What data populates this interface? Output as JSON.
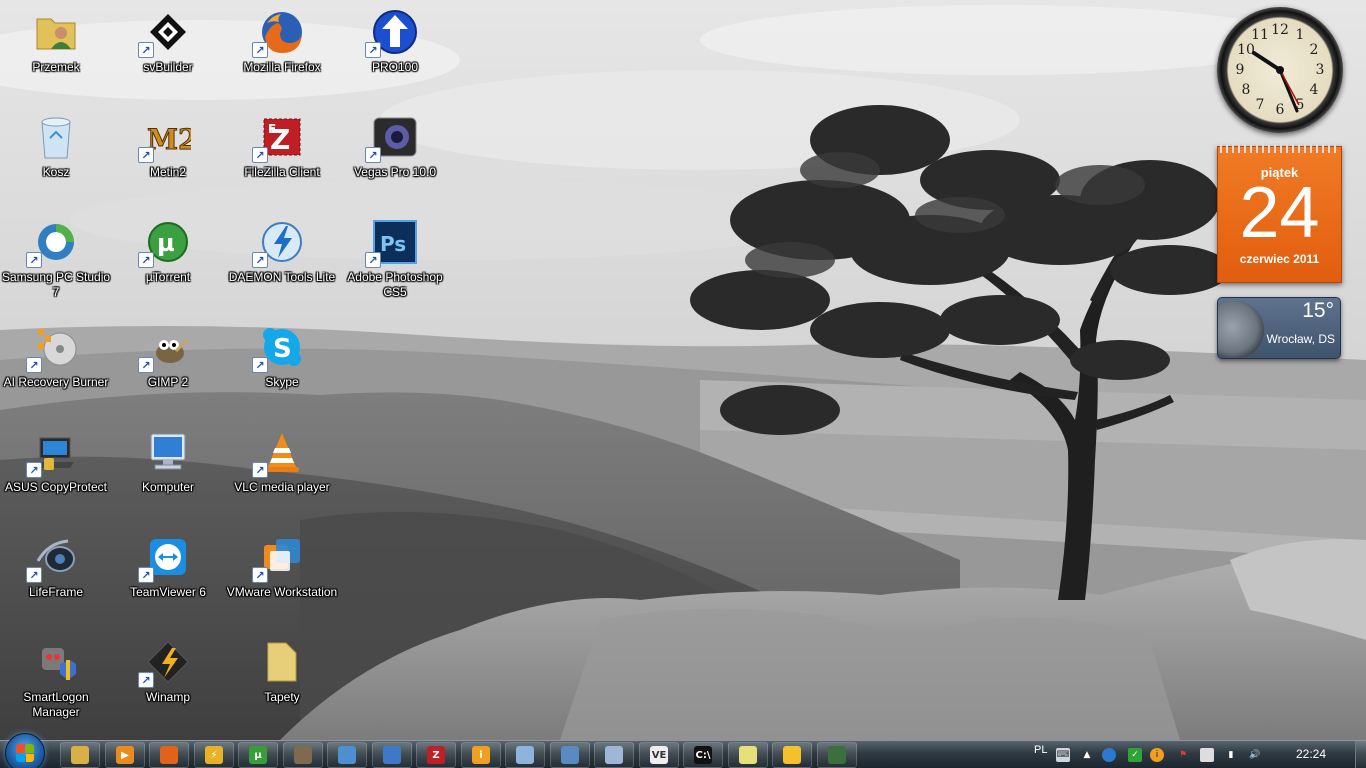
{
  "desktop": {
    "icons": [
      {
        "label": "Przemek",
        "icon": "user-folder-icon"
      },
      {
        "label": "svBuilder",
        "icon": "svbuilder-icon"
      },
      {
        "label": "Mozilla Firefox",
        "icon": "firefox-icon"
      },
      {
        "label": "PRO100",
        "icon": "pro100-icon"
      },
      {
        "label": "Kosz",
        "icon": "recycle-bin-icon"
      },
      {
        "label": "Metin2",
        "icon": "metin2-icon"
      },
      {
        "label": "FileZilla Client",
        "icon": "filezilla-icon"
      },
      {
        "label": "Vegas Pro 10.0",
        "icon": "vegas-icon"
      },
      {
        "label": "Samsung PC Studio 7",
        "icon": "samsung-pc-studio-icon"
      },
      {
        "label": "µTorrent",
        "icon": "utorrent-icon"
      },
      {
        "label": "DAEMON Tools Lite",
        "icon": "daemon-tools-icon"
      },
      {
        "label": "Adobe Photoshop CS5",
        "icon": "photoshop-icon"
      },
      {
        "label": "AI Recovery Burner",
        "icon": "ai-recovery-burner-icon"
      },
      {
        "label": "GIMP 2",
        "icon": "gimp-icon"
      },
      {
        "label": "Skype",
        "icon": "skype-icon"
      },
      {
        "label": "ASUS CopyProtect",
        "icon": "asus-copyprotect-icon"
      },
      {
        "label": "Komputer",
        "icon": "computer-icon"
      },
      {
        "label": "VLC media player",
        "icon": "vlc-icon"
      },
      {
        "label": "LifeFrame",
        "icon": "lifeframe-icon"
      },
      {
        "label": "TeamViewer 6",
        "icon": "teamviewer-icon"
      },
      {
        "label": "VMware Workstation",
        "icon": "vmware-icon"
      },
      {
        "label": "SmartLogon Manager",
        "icon": "smartlogon-icon"
      },
      {
        "label": "Winamp",
        "icon": "winamp-icon"
      },
      {
        "label": "Tapety",
        "icon": "folder-icon"
      }
    ]
  },
  "gadgets": {
    "clock": {
      "numbers": [
        "12",
        "1",
        "2",
        "3",
        "4",
        "5",
        "6",
        "7",
        "8",
        "9",
        "10",
        "11"
      ],
      "time": "22:24"
    },
    "calendar": {
      "day_of_week": "piątek",
      "day": "24",
      "month_year": "czerwiec 2011"
    },
    "weather": {
      "temperature": "15°",
      "location": "Wrocław, DS"
    }
  },
  "taskbar": {
    "start_label": "Start",
    "pinned": [
      {
        "name": "explorer-icon",
        "color": "#d9b046",
        "glyph": ""
      },
      {
        "name": "media-player-icon",
        "color": "#e98c1d",
        "glyph": "▶"
      },
      {
        "name": "firefox-icon",
        "color": "#e0621b",
        "glyph": ""
      },
      {
        "name": "winamp-icon",
        "color": "#e9b125",
        "glyph": "⚡"
      },
      {
        "name": "utorrent-icon",
        "color": "#3a9d3b",
        "glyph": "µ"
      },
      {
        "name": "gimp-icon",
        "color": "#7d6a4f",
        "glyph": ""
      },
      {
        "name": "paint-icon",
        "color": "#4f8fd0",
        "glyph": ""
      },
      {
        "name": "network-icon",
        "color": "#3f78c7",
        "glyph": ""
      },
      {
        "name": "filezilla-icon",
        "color": "#bf2026",
        "glyph": "Z"
      },
      {
        "name": "gg-icon",
        "color": "#f0a020",
        "glyph": "i"
      },
      {
        "name": "notepad-icon",
        "color": "#8fb4dc",
        "glyph": ""
      },
      {
        "name": "remote-desktop-icon",
        "color": "#5a8bc0",
        "glyph": ""
      },
      {
        "name": "calculator-icon",
        "color": "#9fb7d6",
        "glyph": ""
      },
      {
        "name": "vegas-icon",
        "color": "#eeeeee",
        "glyph": "VE"
      },
      {
        "name": "command-prompt-icon",
        "color": "#111111",
        "glyph": "C:\\"
      },
      {
        "name": "sticky-notes-icon",
        "color": "#e7df7a",
        "glyph": ""
      },
      {
        "name": "pro100-taskbar-icon",
        "color": "#f4c02b",
        "glyph": ""
      },
      {
        "name": "task-manager-icon",
        "color": "#3d6f3d",
        "glyph": ""
      }
    ],
    "tray": {
      "language": "PL",
      "clock": "22:24"
    }
  }
}
